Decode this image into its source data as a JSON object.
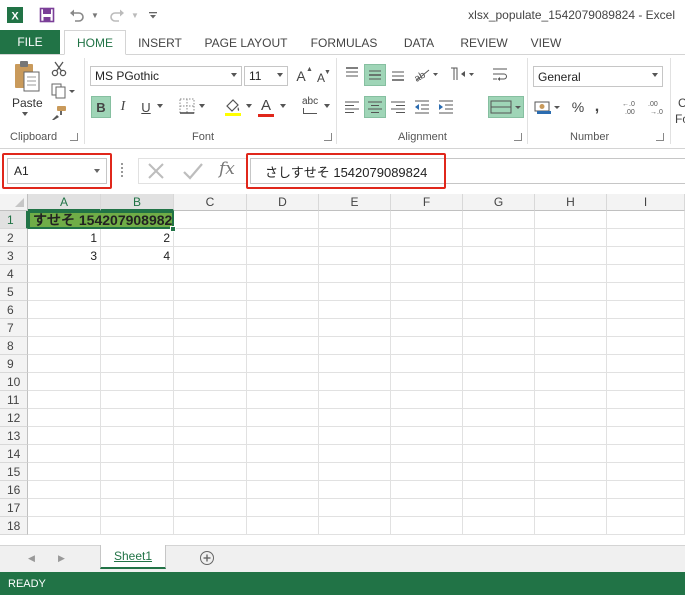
{
  "window": {
    "title": "xlsx_populate_1542079089824 - Excel",
    "brand_color": "#217346"
  },
  "quick_access": {
    "icons": [
      "excel-logo-icon",
      "save-icon",
      "undo-icon",
      "redo-icon",
      "customize-icon"
    ]
  },
  "ribbon": {
    "tabs": [
      {
        "label": "FILE"
      },
      {
        "label": "HOME"
      },
      {
        "label": "INSERT"
      },
      {
        "label": "PAGE LAYOUT"
      },
      {
        "label": "FORMULAS"
      },
      {
        "label": "DATA"
      },
      {
        "label": "REVIEW"
      },
      {
        "label": "VIEW"
      }
    ],
    "active_tab": "HOME",
    "clipboard": {
      "paste_label": "Paste",
      "group_label": "Clipboard"
    },
    "font": {
      "name": "MS PGothic",
      "size": "11",
      "bold": "B",
      "italic": "I",
      "underline": "U",
      "grow": "A",
      "shrink": "A",
      "font_color": "A",
      "phonetic": "abc",
      "group_label": "Font"
    },
    "alignment": {
      "group_label": "Alignment"
    },
    "number": {
      "format": "General",
      "percent": "%",
      "comma": ",",
      "group_label": "Number"
    },
    "cut_off_letters": [
      "C",
      "Fo"
    ]
  },
  "formula_bar": {
    "name_box": "A1",
    "formula": "さしすせそ 1542079089824",
    "fx_label": "fx"
  },
  "sheet": {
    "columns": [
      "A",
      "B",
      "C",
      "D",
      "E",
      "F",
      "G",
      "H",
      "I"
    ],
    "rows": [
      "1",
      "2",
      "3",
      "4",
      "5",
      "6",
      "7",
      "8",
      "9",
      "10",
      "11",
      "12",
      "13",
      "14",
      "15",
      "16",
      "17",
      "18"
    ],
    "cells": {
      "A1": "すせそ 1542079089824",
      "A2": "1",
      "B2": "2",
      "A3": "3",
      "B3": "4"
    },
    "fill_color": "#70ad47",
    "highlight_color": "#e0271b"
  },
  "sheet_tabs": {
    "tabs": [
      "Sheet1"
    ],
    "active": "Sheet1"
  },
  "status": {
    "text": "READY"
  }
}
